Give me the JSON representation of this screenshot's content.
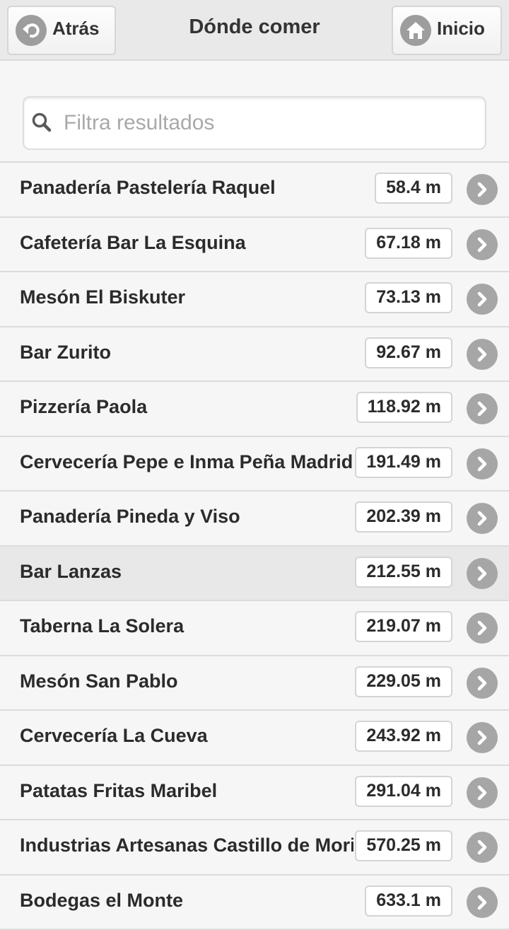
{
  "header": {
    "title": "Dónde comer",
    "back_label": "Atrás",
    "home_label": "Inicio"
  },
  "search": {
    "placeholder": "Filtra resultados",
    "value": ""
  },
  "list": {
    "active_index": 7,
    "items": [
      {
        "name": "Panadería Pastelería Raquel",
        "distance": "58.4 m"
      },
      {
        "name": "Cafetería Bar La Esquina",
        "distance": "67.18 m"
      },
      {
        "name": "Mesón El Biskuter",
        "distance": "73.13 m"
      },
      {
        "name": "Bar Zurito",
        "distance": "92.67 m"
      },
      {
        "name": "Pizzería Paola",
        "distance": "118.92 m"
      },
      {
        "name": "Cervecería Pepe e Inma Peña Madridi",
        "distance": "191.49 m"
      },
      {
        "name": "Panadería Pineda y Viso",
        "distance": "202.39 m"
      },
      {
        "name": "Bar Lanzas",
        "distance": "212.55 m"
      },
      {
        "name": "Taberna La Solera",
        "distance": "219.07 m"
      },
      {
        "name": "Mesón San Pablo",
        "distance": "229.05 m"
      },
      {
        "name": "Cervecería La Cueva",
        "distance": "243.92 m"
      },
      {
        "name": "Patatas Fritas Maribel",
        "distance": "291.04 m"
      },
      {
        "name": "Industrias Artesanas Castillo de Moril",
        "distance": "570.25 m"
      },
      {
        "name": "Bodegas el Monte",
        "distance": "633.1 m"
      }
    ]
  },
  "icons": {
    "back": "back-arrow-icon",
    "home": "home-icon",
    "search": "search-icon",
    "row_arrow": "chevron-right-icon"
  },
  "colors": {
    "header_bg": "#e9e9e9",
    "page_bg": "#f6f6f6",
    "active_row_bg": "#e8e8e8",
    "icon_circle": "#a6a6a6",
    "text": "#2b2b2b"
  }
}
